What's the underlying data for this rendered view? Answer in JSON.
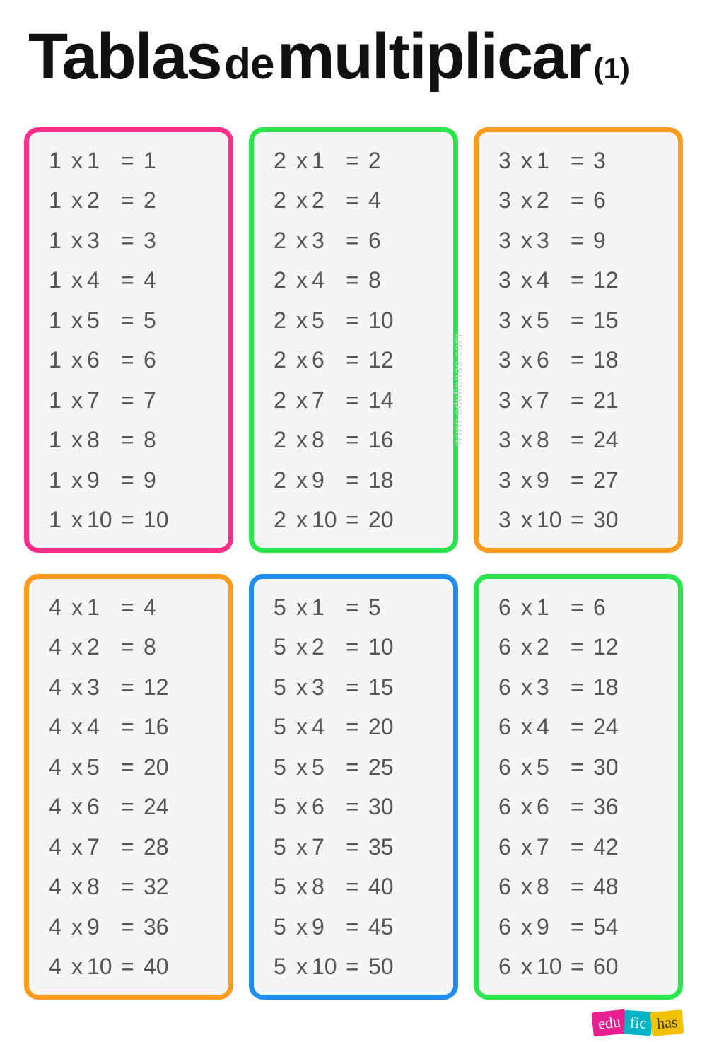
{
  "title": {
    "w1": "Tablas",
    "w2": "de",
    "w3": "multiplicar",
    "w4": "(1)"
  },
  "watermark": "www.edufichas.com",
  "logo": {
    "p1": "edu",
    "p2": "fic",
    "p3": "has"
  },
  "colors": {
    "pink": "#ff2e8b",
    "green": "#28e64b",
    "orange": "#ff9a1a",
    "blue": "#1f8ef1"
  },
  "cards": [
    {
      "color": "pink",
      "n": 1,
      "rows": [
        {
          "a": 1,
          "b": 1,
          "r": 1
        },
        {
          "a": 1,
          "b": 2,
          "r": 2
        },
        {
          "a": 1,
          "b": 3,
          "r": 3
        },
        {
          "a": 1,
          "b": 4,
          "r": 4
        },
        {
          "a": 1,
          "b": 5,
          "r": 5
        },
        {
          "a": 1,
          "b": 6,
          "r": 6
        },
        {
          "a": 1,
          "b": 7,
          "r": 7
        },
        {
          "a": 1,
          "b": 8,
          "r": 8
        },
        {
          "a": 1,
          "b": 9,
          "r": 9
        },
        {
          "a": 1,
          "b": 10,
          "r": 10
        }
      ]
    },
    {
      "color": "green",
      "n": 2,
      "rows": [
        {
          "a": 2,
          "b": 1,
          "r": 2
        },
        {
          "a": 2,
          "b": 2,
          "r": 4
        },
        {
          "a": 2,
          "b": 3,
          "r": 6
        },
        {
          "a": 2,
          "b": 4,
          "r": 8
        },
        {
          "a": 2,
          "b": 5,
          "r": 10
        },
        {
          "a": 2,
          "b": 6,
          "r": 12
        },
        {
          "a": 2,
          "b": 7,
          "r": 14
        },
        {
          "a": 2,
          "b": 8,
          "r": 16
        },
        {
          "a": 2,
          "b": 9,
          "r": 18
        },
        {
          "a": 2,
          "b": 10,
          "r": 20
        }
      ]
    },
    {
      "color": "orange",
      "n": 3,
      "rows": [
        {
          "a": 3,
          "b": 1,
          "r": 3
        },
        {
          "a": 3,
          "b": 2,
          "r": 6
        },
        {
          "a": 3,
          "b": 3,
          "r": 9
        },
        {
          "a": 3,
          "b": 4,
          "r": 12
        },
        {
          "a": 3,
          "b": 5,
          "r": 15
        },
        {
          "a": 3,
          "b": 6,
          "r": 18
        },
        {
          "a": 3,
          "b": 7,
          "r": 21
        },
        {
          "a": 3,
          "b": 8,
          "r": 24
        },
        {
          "a": 3,
          "b": 9,
          "r": 27
        },
        {
          "a": 3,
          "b": 10,
          "r": 30
        }
      ]
    },
    {
      "color": "orange",
      "n": 4,
      "rows": [
        {
          "a": 4,
          "b": 1,
          "r": 4
        },
        {
          "a": 4,
          "b": 2,
          "r": 8
        },
        {
          "a": 4,
          "b": 3,
          "r": 12
        },
        {
          "a": 4,
          "b": 4,
          "r": 16
        },
        {
          "a": 4,
          "b": 5,
          "r": 20
        },
        {
          "a": 4,
          "b": 6,
          "r": 24
        },
        {
          "a": 4,
          "b": 7,
          "r": 28
        },
        {
          "a": 4,
          "b": 8,
          "r": 32
        },
        {
          "a": 4,
          "b": 9,
          "r": 36
        },
        {
          "a": 4,
          "b": 10,
          "r": 40
        }
      ]
    },
    {
      "color": "blue",
      "n": 5,
      "rows": [
        {
          "a": 5,
          "b": 1,
          "r": 5
        },
        {
          "a": 5,
          "b": 2,
          "r": 10
        },
        {
          "a": 5,
          "b": 3,
          "r": 15
        },
        {
          "a": 5,
          "b": 4,
          "r": 20
        },
        {
          "a": 5,
          "b": 5,
          "r": 25
        },
        {
          "a": 5,
          "b": 6,
          "r": 30
        },
        {
          "a": 5,
          "b": 7,
          "r": 35
        },
        {
          "a": 5,
          "b": 8,
          "r": 40
        },
        {
          "a": 5,
          "b": 9,
          "r": 45
        },
        {
          "a": 5,
          "b": 10,
          "r": 50
        }
      ]
    },
    {
      "color": "green",
      "n": 6,
      "rows": [
        {
          "a": 6,
          "b": 1,
          "r": 6
        },
        {
          "a": 6,
          "b": 2,
          "r": 12
        },
        {
          "a": 6,
          "b": 3,
          "r": 18
        },
        {
          "a": 6,
          "b": 4,
          "r": 24
        },
        {
          "a": 6,
          "b": 5,
          "r": 30
        },
        {
          "a": 6,
          "b": 6,
          "r": 36
        },
        {
          "a": 6,
          "b": 7,
          "r": 42
        },
        {
          "a": 6,
          "b": 8,
          "r": 48
        },
        {
          "a": 6,
          "b": 9,
          "r": 54
        },
        {
          "a": 6,
          "b": 10,
          "r": 60
        }
      ]
    }
  ]
}
